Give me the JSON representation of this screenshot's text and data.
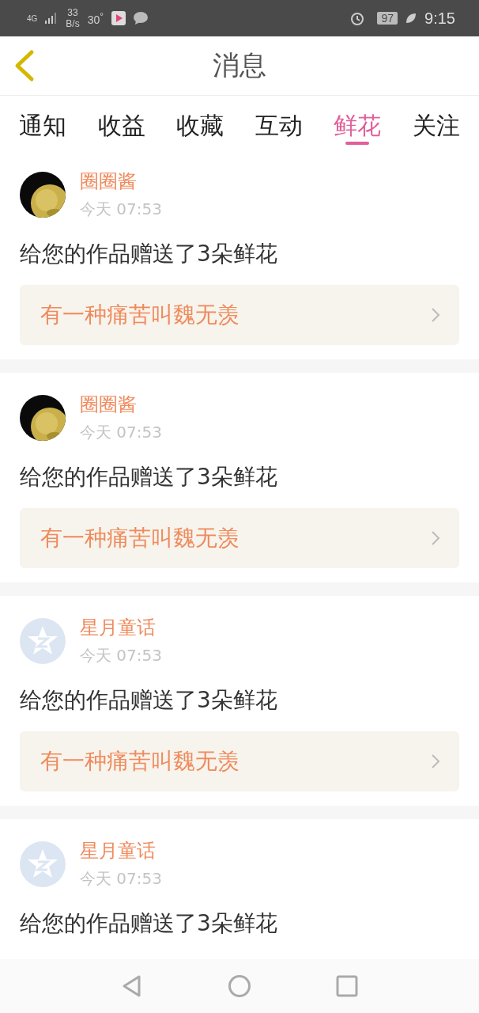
{
  "status_bar": {
    "network": "4G",
    "speed": "33",
    "speed_unit": "B/s",
    "temperature": "30$^{°}$",
    "battery": "97",
    "time": "9:15"
  },
  "header": {
    "title": "消息"
  },
  "tabs": [
    {
      "label": "通知",
      "selected": false
    },
    {
      "label": "收益",
      "selected": false
    },
    {
      "label": "收藏",
      "selected": false
    },
    {
      "label": "互动",
      "selected": false
    },
    {
      "label": "鲜花",
      "selected": true
    },
    {
      "label": "关注",
      "selected": false
    }
  ],
  "messages": [
    {
      "name": "圈圈酱",
      "time": "今天 07:53",
      "text": "给您的作品赠送了3朵鲜花",
      "work": "有一种痛苦叫魏无羡"
    },
    {
      "name": "圈圈酱",
      "time": "今天 07:53",
      "text": "给您的作品赠送了3朵鲜花",
      "work": "有一种痛苦叫魏无羡"
    },
    {
      "avatar": {
        "kind": "default"
      },
      "name": "星月童话",
      "time": "今天 07:53",
      "text": "给您的作品赠送了3朵鲜花",
      "work": "有一种痛苦叫魏无羡"
    },
    {
      "avatar": {
        "kind": "default"
      },
      "name": "星月童话",
      "time": "今天 07:53",
      "text": "给您的作品赠送了3朵鲜花"
    }
  ]
}
